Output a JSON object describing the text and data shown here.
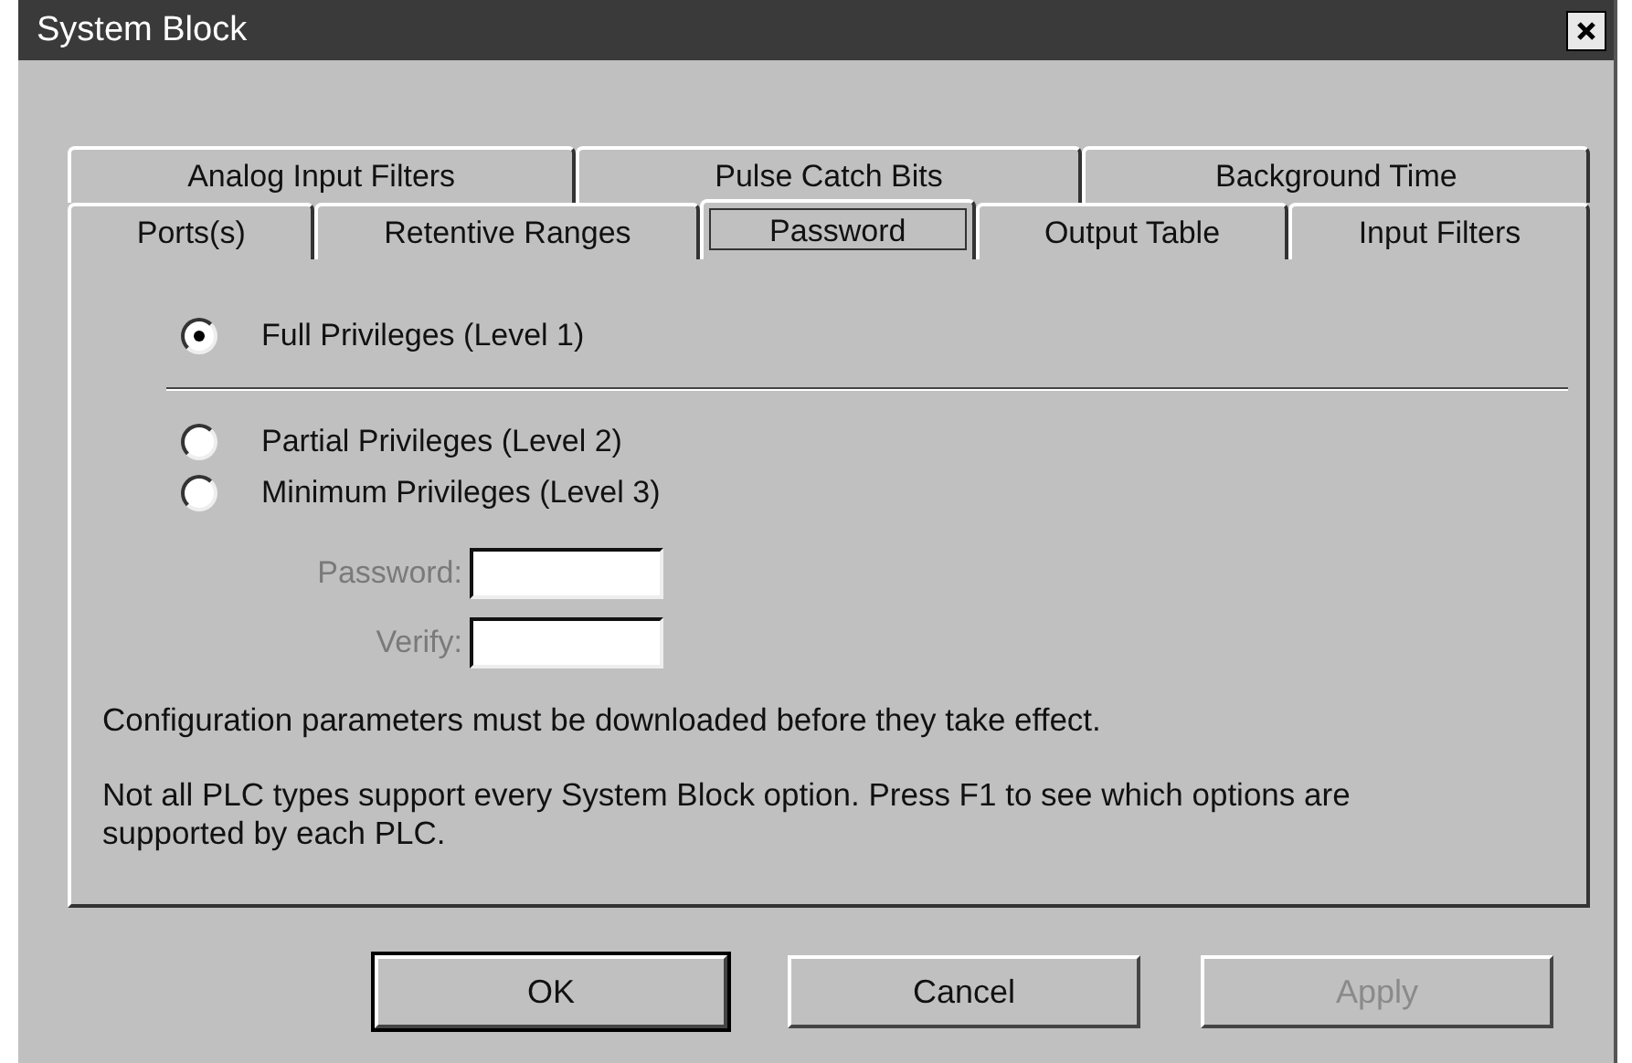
{
  "window": {
    "title": "System Block"
  },
  "tab_rows": [
    {
      "tabs": [
        {
          "label": "Analog Input Filters",
          "selected": false
        },
        {
          "label": "Pulse Catch Bits",
          "selected": false
        },
        {
          "label": "Background Time",
          "selected": false
        }
      ]
    },
    {
      "tabs": [
        {
          "label": "Ports(s)",
          "selected": false
        },
        {
          "label": "Retentive Ranges",
          "selected": false
        },
        {
          "label": "Password",
          "selected": true
        },
        {
          "label": "Output Table",
          "selected": false
        },
        {
          "label": "Input Filters",
          "selected": false
        }
      ]
    }
  ],
  "privileges": [
    {
      "label": "Full Privileges (Level 1)",
      "selected": true
    },
    {
      "label": "Partial Privileges (Level 2)",
      "selected": false
    },
    {
      "label": "Minimum Privileges (Level 3)",
      "selected": false
    }
  ],
  "fields": [
    {
      "label": "Password:",
      "disabled": true
    },
    {
      "label": "Verify:",
      "disabled": true
    }
  ],
  "notes": [
    "Configuration parameters must be downloaded before they take effect.",
    "Not all PLC types support every System Block option. Press F1 to see which options are supported by each PLC."
  ],
  "buttons": [
    {
      "label": "OK",
      "default": true,
      "disabled": false
    },
    {
      "label": "Cancel",
      "default": false,
      "disabled": false
    },
    {
      "label": "Apply",
      "default": false,
      "disabled": true
    }
  ]
}
